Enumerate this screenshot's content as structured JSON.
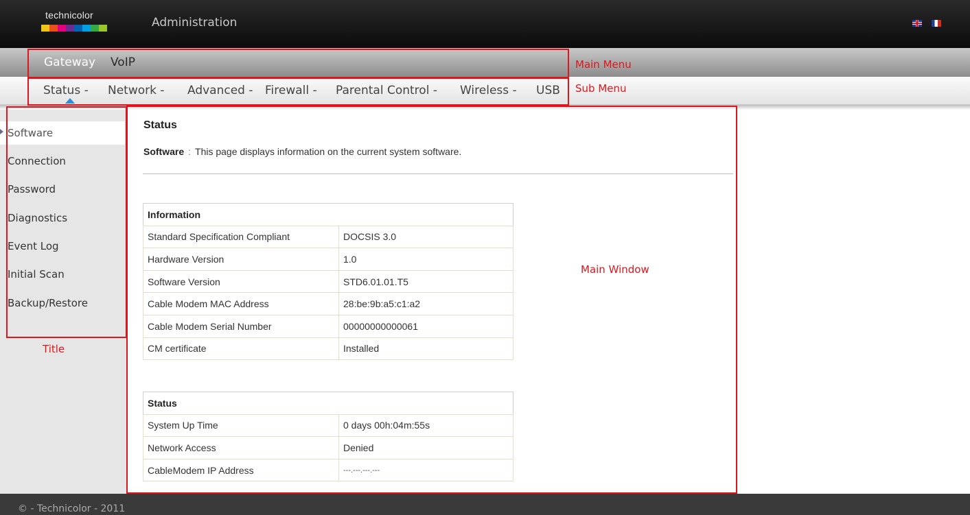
{
  "header": {
    "brand": "technicolor",
    "logo_colors": [
      "#f0c419",
      "#e94e1b",
      "#e4007c",
      "#6b2c91",
      "#0063b0",
      "#00a0e2",
      "#36a846",
      "#9bc62b"
    ],
    "title": "Administration",
    "flags": [
      "uk-flag-icon",
      "france-flag-icon"
    ]
  },
  "main_menu": {
    "items": [
      "Gateway",
      "VoIP"
    ]
  },
  "sub_menu": {
    "items": [
      "Status -",
      "Network -",
      "Advanced -",
      "Firewall -",
      "Parental Control -",
      "Wireless -",
      "USB"
    ]
  },
  "sidebar": {
    "items": [
      "Software",
      "Connection",
      "Password",
      "Diagnostics",
      "Event Log",
      "Initial Scan",
      "Backup/Restore"
    ],
    "active": "Software"
  },
  "content": {
    "title": "Status",
    "desc_label": "Software",
    "desc_sep": ":",
    "desc_text": "This page displays information on the current system software."
  },
  "info_table": {
    "header": "Information",
    "rows": [
      [
        "Standard Specification Compliant",
        "DOCSIS 3.0"
      ],
      [
        "Hardware Version",
        "1.0"
      ],
      [
        "Software Version",
        "STD6.01.01.T5"
      ],
      [
        "Cable Modem MAC Address",
        "28:be:9b:a5:c1:a2"
      ],
      [
        "Cable Modem Serial Number",
        "00000000000061"
      ],
      [
        "CM certificate",
        "Installed"
      ]
    ]
  },
  "status_table": {
    "header": "Status",
    "rows": [
      [
        "System Up Time",
        "0 days 00h:04m:55s"
      ],
      [
        "Network Access",
        "Denied"
      ],
      [
        "CableModem IP Address",
        "---.---.---.---"
      ]
    ]
  },
  "footer": {
    "text": "© - Technicolor - 2011"
  },
  "annotations": {
    "main_menu": "Main Menu",
    "sub_menu": "Sub Menu",
    "title": "Title",
    "main_window": "Main Window",
    "color": "#e0151b"
  }
}
